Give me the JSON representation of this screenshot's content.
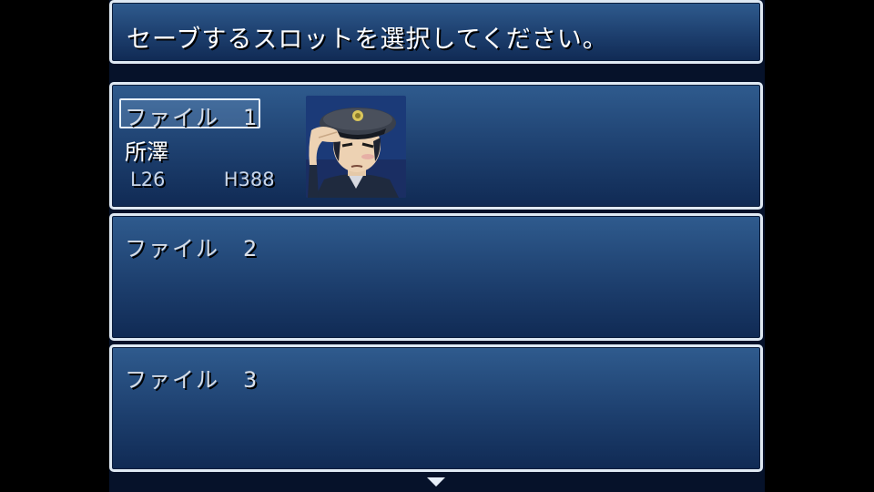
{
  "help": {
    "message": "セーブするスロットを選択してください。"
  },
  "slots": [
    {
      "label": "ファイル　1",
      "actor_name": "所澤",
      "level_text": "L26",
      "hp_text": "H388",
      "selected": true,
      "face_icon": "officer-saluting-portrait"
    },
    {
      "label": "ファイル　2",
      "selected": false
    },
    {
      "label": "ファイル　3",
      "selected": false
    }
  ],
  "scroll_indicator_icon": "down-arrow-icon",
  "colors": {
    "window_top": "#2f5b8e",
    "window_bottom": "#102a54",
    "window_border": "#dfe9f3",
    "text": "#ffffff",
    "sub_text": "#c8d6ea"
  }
}
